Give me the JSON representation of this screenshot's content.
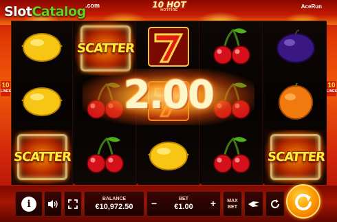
{
  "watermark": {
    "slot": "Slot",
    "catalog": "Catalog",
    "com": ".com"
  },
  "game": {
    "title": "10 HOT",
    "subtitle": "HOTFIRE"
  },
  "provider": "AceRun",
  "lines": {
    "left": {
      "number": "10",
      "label": "LINES"
    },
    "right": {
      "number": "10",
      "label": "LINES"
    }
  },
  "reels": [
    [
      "lemon",
      "lemon",
      "scatter"
    ],
    [
      "scatter",
      "cherry",
      "cherry"
    ],
    [
      "seven",
      "seven",
      "lemon"
    ],
    [
      "cherry",
      "cherry",
      "cherry"
    ],
    [
      "plum",
      "orange",
      "scatter"
    ]
  ],
  "symbols": {
    "scatter_label": "SCATTER"
  },
  "win": {
    "amount": "2.00"
  },
  "controls": {
    "balance_label": "BALANCE",
    "balance_value": "€10,972.50",
    "bet_label": "BET",
    "bet_value": "€1.00",
    "bet_minus": "−",
    "bet_plus": "+",
    "maxbet_line1": "MAX",
    "maxbet_line2": "BET",
    "info": "i"
  },
  "colors": {
    "accent": "#ff9a00",
    "scatter_text": "#ffef3a",
    "brand_green": "#63d21c"
  }
}
